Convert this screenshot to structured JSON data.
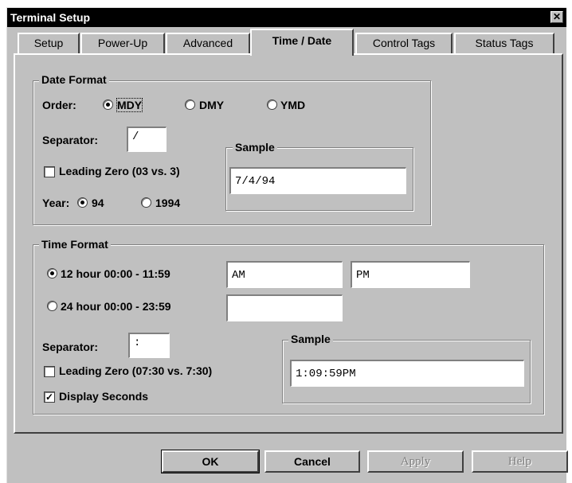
{
  "window": {
    "title": "Terminal Setup",
    "close_glyph": "✕"
  },
  "tabs": [
    {
      "label": "Setup",
      "active": false
    },
    {
      "label": "Power-Up",
      "active": false
    },
    {
      "label": "Advanced",
      "active": false
    },
    {
      "label": "Time / Date",
      "active": true
    },
    {
      "label": "Control Tags",
      "active": false
    },
    {
      "label": "Status Tags",
      "active": false
    }
  ],
  "date_format": {
    "legend": "Date Format",
    "order_label": "Order:",
    "order_options": [
      {
        "label": "MDY",
        "selected": true
      },
      {
        "label": "DMY",
        "selected": false
      },
      {
        "label": "YMD",
        "selected": false
      }
    ],
    "separator_label": "Separator:",
    "separator_value": "/",
    "leading_zero_label": "Leading Zero (03 vs. 3)",
    "leading_zero_checked": false,
    "year_label": "Year:",
    "year_options": [
      {
        "label": "94",
        "selected": true
      },
      {
        "label": "1994",
        "selected": false
      }
    ],
    "sample_legend": "Sample",
    "sample_value": "7/4/94"
  },
  "time_format": {
    "legend": "Time Format",
    "hour12_label": "12 hour 00:00 - 11:59",
    "hour12_selected": true,
    "am_value": "AM",
    "pm_value": "PM",
    "hour24_label": "24 hour 00:00 - 23:59",
    "hour24_selected": false,
    "hour24_value": "",
    "separator_label": "Separator:",
    "separator_value": ":",
    "leading_zero_label": "Leading Zero (07:30 vs. 7:30)",
    "leading_zero_checked": false,
    "display_seconds_label": "Display Seconds",
    "display_seconds_checked": true,
    "sample_legend": "Sample",
    "sample_value": "1:09:59PM"
  },
  "buttons": {
    "ok": "OK",
    "cancel": "Cancel",
    "apply": "Apply",
    "help": "Help"
  },
  "check_glyph": "✓"
}
